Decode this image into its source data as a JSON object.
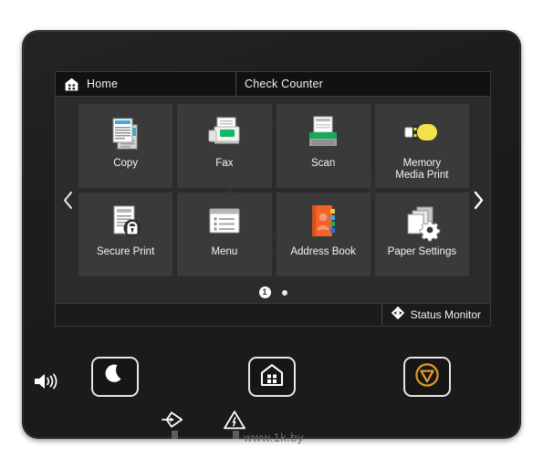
{
  "device": {
    "name": "printer-control-panel"
  },
  "screen": {
    "titlebar": {
      "home_label": "Home",
      "home_icon": "home-icon",
      "check_counter_label": "Check Counter"
    },
    "tiles": [
      {
        "label": "Copy",
        "icon": "copy-icon",
        "row": 1,
        "col": 1
      },
      {
        "label": "Fax",
        "icon": "fax-icon",
        "row": 1,
        "col": 2
      },
      {
        "label": "Scan",
        "icon": "scan-icon",
        "row": 1,
        "col": 3
      },
      {
        "label": "Memory\nMedia Print",
        "icon": "usb-drive-icon",
        "row": 1,
        "col": 4
      },
      {
        "label": "Secure Print",
        "icon": "document-lock-icon",
        "row": 2,
        "col": 1
      },
      {
        "label": "Menu",
        "icon": "list-window-icon",
        "row": 2,
        "col": 2
      },
      {
        "label": "Address Book",
        "icon": "address-book-icon",
        "row": 2,
        "col": 3
      },
      {
        "label": "Paper Settings",
        "icon": "paper-gear-icon",
        "row": 2,
        "col": 4
      }
    ],
    "navigation": {
      "prev_icon": "chevron-left-icon",
      "next_icon": "chevron-right-icon"
    },
    "pagination": {
      "current_page": "1",
      "total_pages": 2
    },
    "statusbar": {
      "status_monitor_label": "Status Monitor",
      "status_monitor_icon": "eye-diamond-icon"
    }
  },
  "hardware": {
    "buttons": [
      {
        "name": "sleep-button",
        "icon": "crescent-moon-icon"
      },
      {
        "name": "home-button",
        "icon": "home-icon"
      },
      {
        "name": "stop-button",
        "icon": "stop-triangle-icon"
      }
    ],
    "volume_icon": "speaker-volume-icon",
    "indicators": [
      {
        "name": "data-indicator",
        "icon": "data-arrow-icon"
      },
      {
        "name": "error-indicator",
        "icon": "warning-triangle-icon"
      }
    ]
  },
  "colors": {
    "panel": "#1b1b1b",
    "screen_bg": "#2b2b2b",
    "tile_bg": "#3a3a3a",
    "titlebar_bg": "#111111",
    "accent_copy_blue": "#3fa9dd",
    "accent_fax_green": "#14b866",
    "accent_scan_green": "#17a85a",
    "accent_usb_yellow": "#f4e04a",
    "accent_address_orange": "#f2622a",
    "accent_stop_amber": "#e09a28"
  },
  "watermark": {
    "url": "www.1k.by",
    "ghost_text": "by"
  }
}
